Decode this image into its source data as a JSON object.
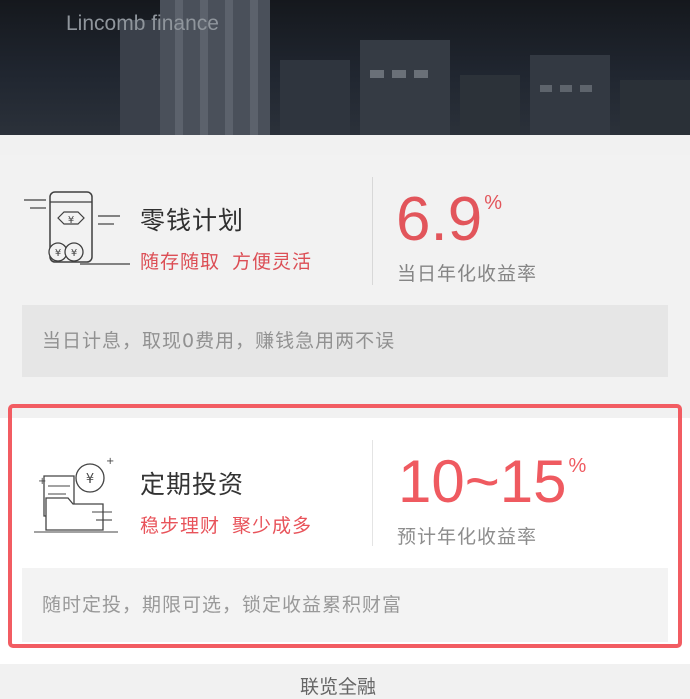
{
  "header": {
    "brand": "Lincomb finance"
  },
  "products": [
    {
      "name": "零钱计划",
      "tags": [
        "随存随取",
        "方便灵活"
      ],
      "rate": "6.9",
      "rate_unit": "%",
      "rate_label": "当日年化收益率",
      "description": "当日计息，取现0费用，赚钱急用两不误",
      "icon": "phone-coin-icon",
      "selected": false
    },
    {
      "name": "定期投资",
      "tags": [
        "稳步理财",
        "聚少成多"
      ],
      "rate": "10~15",
      "rate_unit": "%",
      "rate_label": "预计年化收益率",
      "description": "随时定投，期限可选，锁定收益累积财富",
      "icon": "folder-coin-icon",
      "selected": true
    }
  ],
  "footer": {
    "partial_text": "联览全融"
  },
  "colors": {
    "accent": "#ef5a60",
    "highlight_border": "#f25c62",
    "header_bg": "#1c2027"
  }
}
